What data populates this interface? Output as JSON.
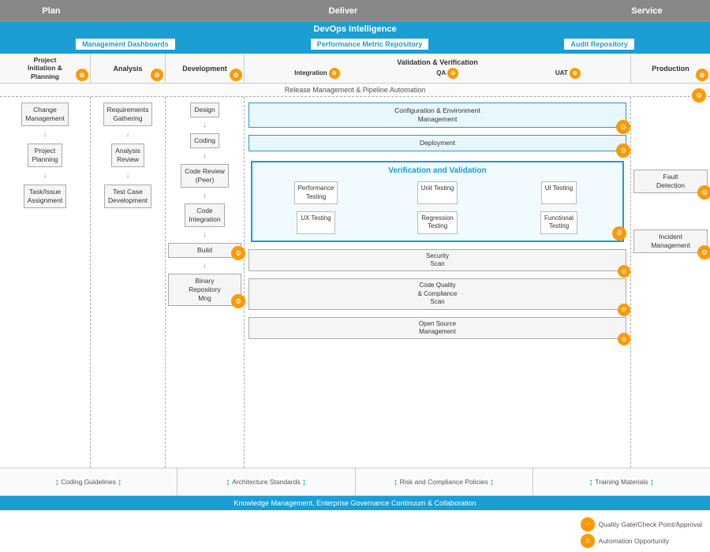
{
  "phases": {
    "plan": "Plan",
    "deliver": "Deliver",
    "service": "Service"
  },
  "devops": {
    "title": "DevOps Intelligence",
    "items": [
      "Management Dashboards",
      "Performance Metric Repository",
      "Audit Repository"
    ]
  },
  "pipeline": {
    "stages": [
      {
        "label": "Project\nInitiation &\nPlanning",
        "hasIcon": true
      },
      {
        "label": "Analysis",
        "hasIcon": true
      },
      {
        "label": "Development",
        "hasIcon": true
      },
      {
        "label": "Validation & Verification",
        "hasIcon": false
      },
      {
        "label": "Production",
        "hasIcon": true
      }
    ],
    "vv_sub": [
      {
        "label": "Integration",
        "hasIcon": true
      },
      {
        "label": "QA",
        "hasIcon": true
      },
      {
        "label": "UAT",
        "hasIcon": true
      }
    ]
  },
  "release_bar": "Release Management & Pipeline Automation",
  "project_col": {
    "items": [
      "Change\nManagement",
      "Project\nPlanning",
      "Task/Issue\nAssignment"
    ]
  },
  "analysis_col": {
    "items": [
      "Requirements\nGathering",
      "Analysis\nReview",
      "Test Case\nDevelopment"
    ]
  },
  "dev_col": {
    "items": [
      "Design",
      "Coding",
      "Code Review\n(Peer)",
      "Code\nIntegration",
      "Build",
      "Binary\nRepository\nMng"
    ]
  },
  "vv_col": {
    "title": "Verification and Validation",
    "row1": [
      "Performance\nTesting",
      "Unit Testing",
      "UI Testing"
    ],
    "row2": [
      "UX Testing",
      "Regression\nTesting",
      "Functional\nTesting"
    ],
    "config": "Configuration & Environment\nManagement",
    "deployment": "Deployment",
    "security_scan": "Security\nScan",
    "code_quality": "Code Quality\n& Compliance\nScan",
    "open_source": "Open Source\nManagement"
  },
  "prod_col": {
    "items": [
      "Fault\nDetection",
      "Incident\nManagement"
    ]
  },
  "bottom": {
    "standards": [
      "Coding Guidelines",
      "Architecture Standards",
      "Risk and Compliance Policies",
      "Training Materials"
    ],
    "knowledge": "Knowledge Management, Enterprise Governance Continuum & Collaboration"
  },
  "legend": {
    "quality_label": "Quality Gate/Check Point/Approval",
    "automation_label": "Automation Opportunity"
  }
}
